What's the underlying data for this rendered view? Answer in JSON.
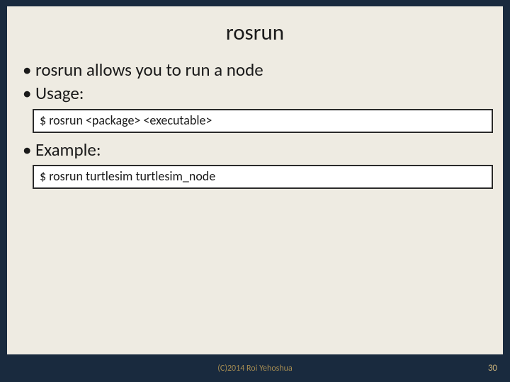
{
  "title": "rosrun",
  "bullets": {
    "intro": "rosrun allows you to run a node",
    "usage_label": "Usage:",
    "example_label": "Example:"
  },
  "code": {
    "usage": "$ rosrun <package> <executable>",
    "example": "$ rosrun turtlesim turtlesim_node"
  },
  "footer": {
    "copyright": "(C)2014 Roi Yehoshua",
    "page": "30"
  }
}
